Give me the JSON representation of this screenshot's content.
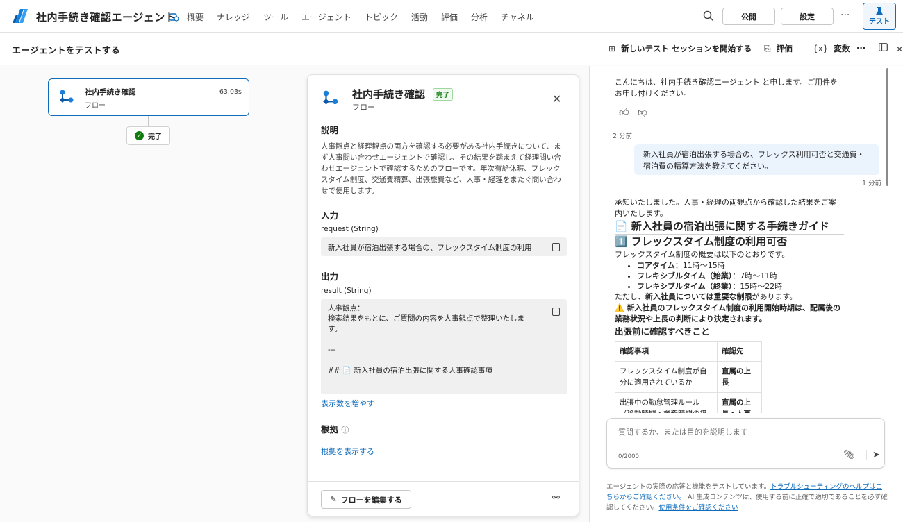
{
  "app": {
    "title": "社内手続き確認エージェント",
    "nav": [
      "概要",
      "ナレッジ",
      "ツール",
      "エージェント",
      "トピック",
      "活動",
      "評価",
      "分析",
      "チャネル"
    ],
    "publish_label": "公開",
    "settings_label": "設定",
    "more_label": "···",
    "test_label": "テスト"
  },
  "subbar": {
    "title": "エージェントをテストする",
    "new_session_label": "新しいテスト セッションを開始する",
    "evaluate_label": "評価",
    "variables_label": "変数",
    "variables_icon": "{x}",
    "more_label": "···"
  },
  "canvas": {
    "node": {
      "title": "社内手続き確認",
      "subtitle": "フロー",
      "duration": "63.03s"
    },
    "status_label": "完了"
  },
  "detail": {
    "title": "社内手続き確認",
    "badge": "完了",
    "subtitle": "フロー",
    "description_heading": "説明",
    "description": "人事観点と経理観点の両方を確認する必要がある社内手続きについて、まず人事問い合わせエージェントで確認し、その結果を踏まえて経理問い合わせエージェントで確認するためのフローです。年次有給休暇、フレックスタイム制度、交通費精算、出張旅費など、人事・経理をまたぐ問い合わせで使用します。",
    "input_heading": "入力",
    "input_label": "request (String)",
    "input_value": "新入社員が宿泊出張する場合の、フレックスタイム制度の利用",
    "output_heading": "出力",
    "output_label": "result (String)",
    "output_lines": [
      "人事観点：",
      "検索結果をもとに、ご質問の内容を人事観点で整理いたしま",
      "す。",
      "",
      "---",
      "",
      "## 📄 新入社員の宿泊出張に関する人事確認事項"
    ],
    "show_more_label": "表示数を増やす",
    "grounds_heading": "根拠",
    "show_grounds_label": "根拠を表示する",
    "edit_flow_label": "フローを編集する"
  },
  "chat": {
    "greeting_line1": "こんにちは、社内手続き確認エージェント と申します。ご用件を",
    "greeting_line2": "お申し付けください。",
    "ts_user": "2 分前",
    "user_message_line1": "新入社員が宿泊出張する場合の、フレックス利用可否と交通費・",
    "user_message_line2": "宿泊費の精算方法を教えてください。",
    "ts_reply": "1 分前",
    "reply_intro_line1": "承知いたしました。人事・経理の両観点から確認した結果をご案",
    "reply_intro_line2": "内いたします。",
    "guide_heading": "📄 新入社員の宿泊出張に関する手続きガイド",
    "section1_heading": "1️⃣ フレックスタイム制度の利用可否",
    "section1_intro": "フレックスタイム制度の概要は以下のとおりです。",
    "bullets": [
      {
        "bold": "コアタイム",
        "rest": "：11時〜15時"
      },
      {
        "bold": "フレキシブルタイム（始業）",
        "rest": "：7時〜11時"
      },
      {
        "bold": "フレキシブルタイム（終業）",
        "rest": "：15時〜22時"
      }
    ],
    "note_pre": "ただし、",
    "note_bold": "新入社員については重要な制限",
    "note_post": "があります。",
    "warning": "⚠️ 新入社員のフレックスタイム制度の利用開始時期は、配属後の業務状況や上長の判断により決定されます。",
    "check_heading": "出張前に確認すべきこと",
    "table_headers": [
      "確認事項",
      "確認先"
    ],
    "table_rows": [
      [
        "フレックスタイム制度が自分に適用されているか",
        "直属の上長"
      ],
      [
        "出張中の勤怠管理ルール（移動時間・業務時間の扱い）",
        "直属の上長・人事"
      ]
    ],
    "composer_placeholder": "質問するか、または目的を説明します",
    "composer_count": "0/2000",
    "disclaimer_pre": "エージェントの実際の応答と機能をテストしています。",
    "disclaimer_link1": "トラブルシューティングのヘルプはこちらからご確認ください。",
    "disclaimer_mid": " AI 生成コンテンツは、使用する前に正確で適切であることを必ず確認してください。",
    "disclaimer_link2": "使用条件をご確認ください"
  },
  "colors": {
    "accent": "#0f6cbd",
    "success": "#107c10",
    "user_bubble": "#ebf3fc"
  }
}
